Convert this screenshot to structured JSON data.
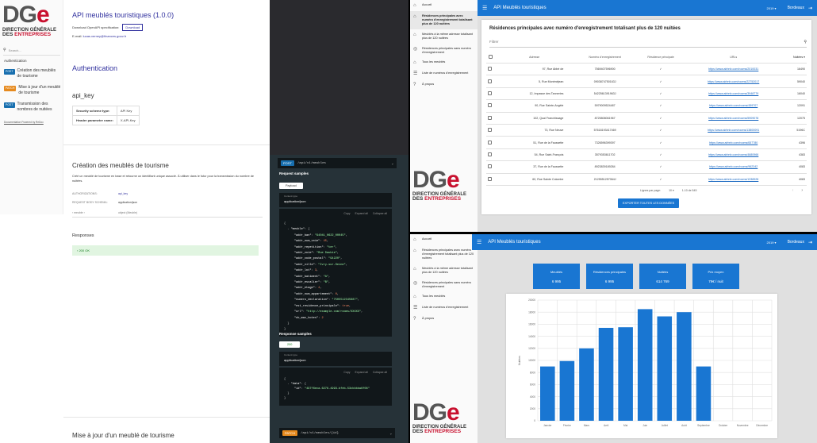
{
  "logo": {
    "big_d": "DG",
    "big_e": "e",
    "line1": "DIRECTION GÉNÉRALE",
    "line2_des": "DES ",
    "line2_ent": "ENTREPRISES"
  },
  "doc": {
    "title": "API meublés touristiques (1.0.0)",
    "download_label": "Download OpenAPI specification:",
    "download_button": "Download",
    "email_label": "E-mail:",
    "email": "lucas.verney@finances.gouv.fr",
    "search_placeholder": "Search...",
    "side_section": "Authentication",
    "side_items": [
      {
        "method": "POST",
        "label": "Création des meublés de tourisme",
        "color": "#186faf"
      },
      {
        "method": "PATCH",
        "label": "Mise à jour d'un meublé de tourisme",
        "color": "#e68a1e"
      },
      {
        "method": "POST",
        "label": "Transmission des nombres de nuitées",
        "color": "#186faf"
      }
    ],
    "side_footer": "Documentation Powered by ReDoc",
    "auth_title": "Authentication",
    "api_key_title": "api_key",
    "security_rows": [
      {
        "k": "Security scheme type:",
        "v": "API Key"
      },
      {
        "k": "Header parameter name:",
        "v": "X-API-Key"
      }
    ],
    "create_title": "Création des meublés de tourisme",
    "create_desc": "Créé un meublé de tourisme en base et retourne un identifiant unique associé. À utiliser dans le futur pour la transmission du nombre de nuitées.",
    "authorizations_label": "AUTHORIZATIONS:",
    "authorizations_value": "api_key",
    "body_schema_label": "REQUEST BODY SCHEMA:",
    "body_schema_value": "application/json",
    "meuble_label": "› meuble ›",
    "meuble_value": "object (Meuble)",
    "responses_title": "Responses",
    "response_200": "› 200 OK",
    "update_title": "Mise à jour d'un meublé de tourisme"
  },
  "code": {
    "endpoint1_method": "POST",
    "endpoint1_path": "/api/v1/meubles",
    "request_samples": "Request samples",
    "payload_tab": "Payload",
    "content_type_label": "Content type",
    "content_type": "application/json",
    "copy": "Copy",
    "expand": "Expand all",
    "collapse": "Collapse all",
    "request_lines": [
      "{",
      "  - \"meuble\": {",
      "      \"addr_ban\": \"94041_0622_00045\",",
      "      \"addr_num_voie\": 45,",
      "      \"addr_repetition\": \"ter\",",
      "      \"addr_voie\": \"Rue Daubie\",",
      "      \"addr_code_postal\": \"94220\",",
      "      \"addr_ville\": \"Ivry-sur-Seine\",",
      "      \"addr_lot\": 3,",
      "      \"addr_batiment\": \"A\",",
      "      \"addr_escalier\": \"B\",",
      "      \"addr_etage\": 4,",
      "      \"addr_num_appartement\": 0,",
      "      \"numero_declaration\": \"7505512345687\",",
      "      \"est_residence_principale\": true,",
      "      \"url\": \"http://example.com/rooms/XXXXX\",",
      "      \"nb_max_hotes\": 2",
      "  }",
      "}"
    ],
    "response_samples": "Response samples",
    "tab_200": "200",
    "response_lines": [
      "{",
      "  - \"data\": {",
      "      \"id\": \"497f6eca-6276-4993-bfeb-53cbbbba6f08\"",
      "  }",
      "}"
    ],
    "endpoint2_method": "PATCH",
    "endpoint2_path": "/api/v1/meubles/{id}"
  },
  "app": {
    "title": "API Meublés touristiques",
    "year": "2019 ▾",
    "city": "Bordeaux",
    "nav": [
      {
        "icon": "home-icon",
        "label": "Accueil"
      },
      {
        "icon": "home-icon",
        "label": "Résidences principales avec numéro d'enregistrement totalisant plus de 120 nuitées"
      },
      {
        "icon": "home-icon",
        "label": "Meublés à la même adresse totalisant plus de 120 nuitées"
      },
      {
        "icon": "target-icon",
        "label": "Résidences principales sans numéro d'enregistrement"
      },
      {
        "icon": "home-icon",
        "label": "Tous les meublés"
      },
      {
        "icon": "list-icon",
        "label": "Liste de numéros d'enregistrement"
      },
      {
        "icon": "help-icon",
        "label": "À propos"
      }
    ]
  },
  "table_page": {
    "title": "Résidences principales avec numéro d'enregistrement totalisant plus de 120 nuitées",
    "filter": "Filtrer",
    "columns": [
      "Adresse",
      "Numéro d'enregistrement",
      "Résidence principale",
      "URLs",
      "Nuitées ▾"
    ],
    "rows": [
      {
        "addr": "97, Rue Abbé de",
        "num": "7569407596900",
        "res": "✓",
        "url": "https://www.airbnb.com/rooms/2010031",
        "n": "16490"
      },
      {
        "addr": "5, Rue Montméjean",
        "num": "0903874750163J",
        "res": "✓",
        "url": "https://www.airbnb.com/rooms/22752017",
        "n": "59040"
      },
      {
        "addr": "12, Impasse des Tanneries",
        "num": "5422561391963J",
        "res": "✓",
        "url": "https://www.airbnb.com/rooms/3948779",
        "n": "16040"
      },
      {
        "addr": "90, Rue Sainte-Angèle",
        "num": "5979009524487",
        "res": "✓",
        "url": "https://www.airbnb.com/rooms/459707",
        "n": "12091"
      },
      {
        "addr": "102, Quai Franchissage",
        "num": "8725808061967",
        "res": "✓",
        "url": "https://www.airbnb.com/rooms/5909078",
        "n": "12075"
      },
      {
        "addr": "73, Rue Neuve",
        "num": "57618193417469",
        "res": "✓",
        "url": "https://www.airbnb.com/rooms/13800091",
        "n": "5196C"
      },
      {
        "addr": "51, Rue de la Faussette",
        "num": "7326596399397",
        "res": "✓",
        "url": "https://www.airbnb.com/rooms/657780",
        "n": "4396"
      },
      {
        "addr": "54, Rue Saint-François",
        "num": "3579353611702",
        "res": "✓",
        "url": "https://www.airbnb.com/rooms/4680966",
        "n": "4383"
      },
      {
        "addr": "37, Rue de la Faussette",
        "num": "8923839189284",
        "res": "✓",
        "url": "https://www.airbnb.com/rooms/962342",
        "n": "4083"
      },
      {
        "addr": "60, Rue Sainte Colombe",
        "num": "2125551257064J",
        "res": "✓",
        "url": "https://www.airbnb.com/rooms/1338928",
        "n": "4083"
      }
    ],
    "rows_per_page_label": "Lignes par page:",
    "rows_per_page": "10 ▾",
    "range": "1-10 de 545",
    "export_button": "EXPORTER TOUTES LES DONNÉES"
  },
  "dashboard": {
    "kpis": [
      {
        "label": "Meublés",
        "value": "6 995"
      },
      {
        "label": "Résidences principales",
        "value": "6 995"
      },
      {
        "label": "Nuitées",
        "value": "614 769"
      },
      {
        "label": "Prix moyen",
        "value": "79€ / nuit"
      }
    ]
  },
  "chart_data": {
    "type": "bar",
    "categories": [
      "Janvier",
      "Février",
      "Mars",
      "Avril",
      "Mai",
      "Juin",
      "Juillet",
      "Août",
      "Septembre",
      "Octobre",
      "Novembre",
      "Décembre"
    ],
    "values": [
      9000,
      9900,
      12000,
      15400,
      15500,
      18500,
      17300,
      18000,
      9000,
      0,
      0,
      0
    ],
    "ylabel": "Nuitées",
    "ylim": [
      0,
      20000
    ],
    "yticks": [
      "0",
      "2000",
      "4000",
      "6000",
      "8000",
      "10000",
      "12000",
      "14000",
      "16000",
      "18000",
      "20000"
    ],
    "color": "#1976d2",
    "grid": true
  }
}
